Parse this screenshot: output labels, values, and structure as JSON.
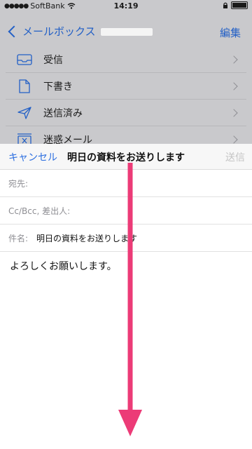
{
  "status_bar": {
    "carrier": "SoftBank",
    "time": "14:19"
  },
  "mailbox_screen": {
    "back_label": "メールボックス",
    "edit_label": "編集",
    "items": [
      {
        "label": "受信",
        "icon": "inbox-icon"
      },
      {
        "label": "下書き",
        "icon": "document-icon"
      },
      {
        "label": "送信済み",
        "icon": "paper-plane-icon"
      },
      {
        "label": "迷惑メール",
        "icon": "junk-icon"
      }
    ]
  },
  "compose": {
    "cancel_label": "キャンセル",
    "title": "明日の資料をお送りします",
    "send_label": "送信",
    "to_label": "宛先:",
    "ccbcc_label": "Cc/Bcc, 差出人:",
    "subject_label": "件名:",
    "subject_value": "明日の資料をお送りします",
    "body": "よろしくお願いします。"
  },
  "colors": {
    "accent": "#2d6fe0",
    "arrow": "#ec3b77",
    "disabled": "#c4c4c4"
  }
}
